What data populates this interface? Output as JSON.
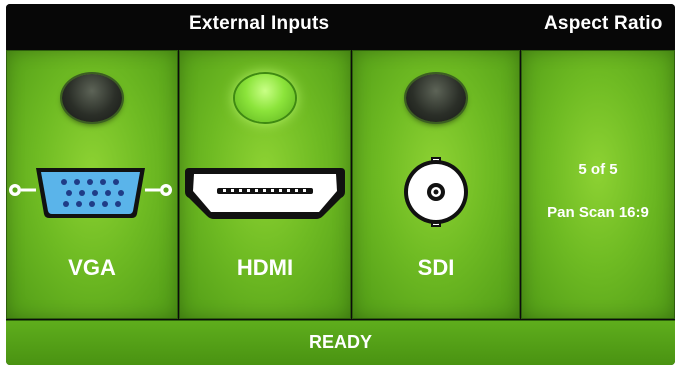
{
  "header": {
    "title": "External Inputs",
    "aspect_title": "Aspect Ratio"
  },
  "inputs": [
    {
      "label": "VGA",
      "icon": "vga-port-icon",
      "active": false
    },
    {
      "label": "HDMI",
      "icon": "hdmi-port-icon",
      "active": true
    },
    {
      "label": "SDI",
      "icon": "sdi-bnc-port-icon",
      "active": false
    }
  ],
  "aspect": {
    "position": "5 of 5",
    "mode": "Pan Scan 16:9"
  },
  "status": "READY",
  "colors": {
    "panel_green": "#6fbb23",
    "led_active": "#8ce43b",
    "text": "#ffffff",
    "bar_black": "#070707"
  }
}
